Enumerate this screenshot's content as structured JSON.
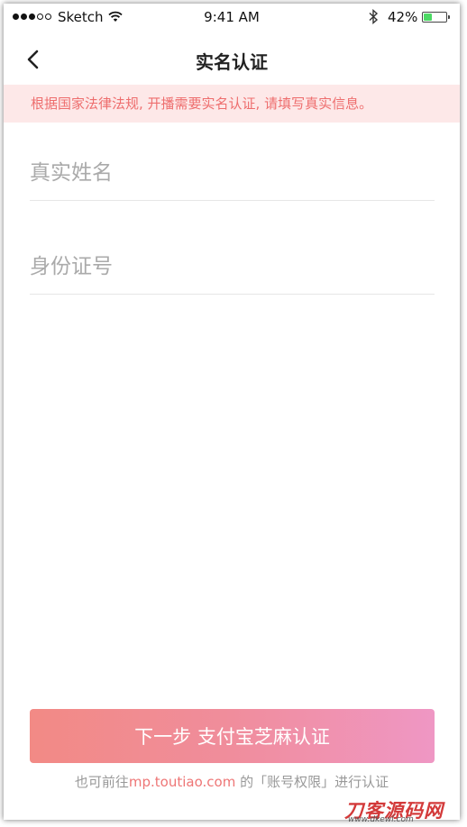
{
  "status_bar": {
    "carrier": "Sketch",
    "time": "9:41 AM",
    "battery_pct": "42%",
    "battery_level": 0.42,
    "signal_bars_filled": 3,
    "signal_bars_total": 5
  },
  "nav": {
    "title": "实名认证",
    "back_icon": "chevron-left-icon"
  },
  "notice": {
    "text": "根据国家法律法规, 开播需要实名认证, 请填写真实信息。"
  },
  "form": {
    "name_placeholder": "真实姓名",
    "id_placeholder": "身份证号"
  },
  "actions": {
    "submit_label": "下一步 支付宝芝麻认证"
  },
  "footnote": {
    "prefix": "也可前往",
    "link": "mp.toutiao.com",
    "suffix": " 的「账号权限」进行认证"
  },
  "watermark": {
    "main": "刀客源码网",
    "url": "www.dkewl.com"
  },
  "colors": {
    "accent_red": "#ee6e6e",
    "notice_bg": "#fde8e8",
    "gradient_start": "#f28a85",
    "gradient_end": "#ef97c4"
  }
}
